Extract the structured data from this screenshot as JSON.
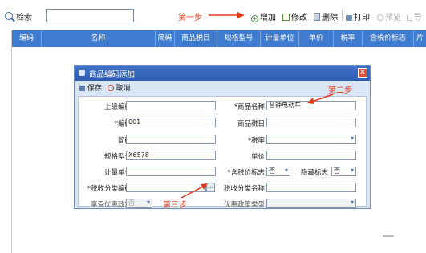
{
  "toolbar": {
    "search_label": "检索",
    "search_value": "",
    "step1": "第一步",
    "add": "增加",
    "edit": "修改",
    "delete": "删除",
    "print": "打印",
    "preview": "预览",
    "export": "导"
  },
  "table": {
    "columns": [
      "编码",
      "名称",
      "简码",
      "商品税目",
      "规格型号",
      "计量单位",
      "单价",
      "税率",
      "含税价标志",
      "片"
    ]
  },
  "dialog": {
    "title": "商品编码添加",
    "save": "保存",
    "cancel": "取消",
    "step2": "第二步",
    "step3": "第三步",
    "fields": {
      "parent_code_label": "上级编码",
      "product_name_label": "*商品名称",
      "product_name_value": "台钟电动车",
      "code_label": "*编码",
      "code_value": "001",
      "tax_item_label": "商品税目",
      "short_code_label": "简码",
      "tax_rate_label": "*税率",
      "spec_label": "规格型号",
      "spec_value": "X6578",
      "unit_price_label": "单价",
      "unit_label": "计量单位",
      "tax_included_label": "*含税价标志",
      "tax_included_value": "否",
      "hidden_flag_label": "隐藏标志",
      "hidden_flag_value": "否",
      "tax_class_code_label": "*税收分类编码",
      "tax_class_name_label": "税收分类名称",
      "preferential_label": "享受优惠政策",
      "preferential_value": "否",
      "preferential_type_label": "优惠政策类型"
    }
  }
}
